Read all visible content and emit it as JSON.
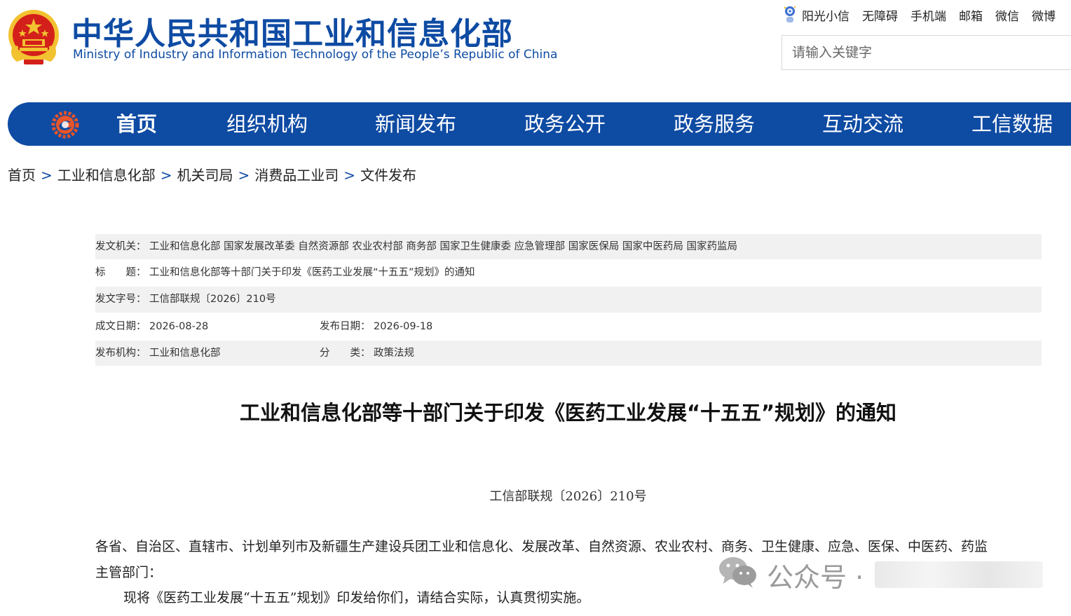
{
  "header": {
    "title_cn": "中华人民共和国工业和信息化部",
    "title_en": "Ministry of Industry and Information Technology of the People’s Republic of China",
    "emblem_icon": "national-emblem-icon",
    "top_links": [
      "阳光小信",
      "无障碍",
      "手机端",
      "邮箱",
      "微信",
      "微博"
    ],
    "search_placeholder": "请输入关键字"
  },
  "nav": {
    "logo_icon": "miit-logo-icon",
    "items": [
      "首页",
      "组织机构",
      "新闻发布",
      "政务公开",
      "政务服务",
      "互动交流",
      "工信数据"
    ],
    "active": "首页"
  },
  "breadcrumb": {
    "items": [
      "首页",
      "工业和信息化部",
      "机关司局",
      "消费品工业司",
      "文件发布"
    ],
    "separator": ">"
  },
  "meta": {
    "issuer_label": "发文机关：",
    "issuer": "工业和信息化部 国家发展改革委 自然资源部 农业农村部 商务部 国家卫生健康委 应急管理部 国家医保局 国家中医药局 国家药监局",
    "title_label": "标　　题：",
    "title": "工业和信息化部等十部门关于印发《医药工业发展“十五五”规划》的通知",
    "docno_label": "发文字号：",
    "docno": "工信部联规〔2026〕210号",
    "created_label": "成文日期：",
    "created": "2026-08-28",
    "published_label": "发布日期：",
    "published": "2026-09-18",
    "org_label": "发布机构：",
    "org": "工业和信息化部",
    "category_label": "分　　类：",
    "category": "政策法规"
  },
  "article": {
    "title": "工业和信息化部等十部门关于印发《医药工业发展“十五五”规划》的通知",
    "doc_number": "工信部联规〔2026〕210号",
    "para1_line1": "各省、自治区、直辖市、计划单列市及新疆生产建设兵团工业和信息化、发展改革、自然资源、农业农村、商务、卫生健康、应急、医保、中医药、药监",
    "para1_line2": "主管部门：",
    "para2": "现将《医药工业发展“十五五”规划》印发给你们，请结合实际，认真贯彻实施。"
  },
  "watermark": {
    "icon": "wechat-icon",
    "text": "公众号 ·"
  },
  "colors": {
    "brand_blue": "#0e4ba3",
    "emblem_red": "#d4201a",
    "emblem_gold": "#f2c230",
    "meta_shade": "#f1f1f1"
  }
}
